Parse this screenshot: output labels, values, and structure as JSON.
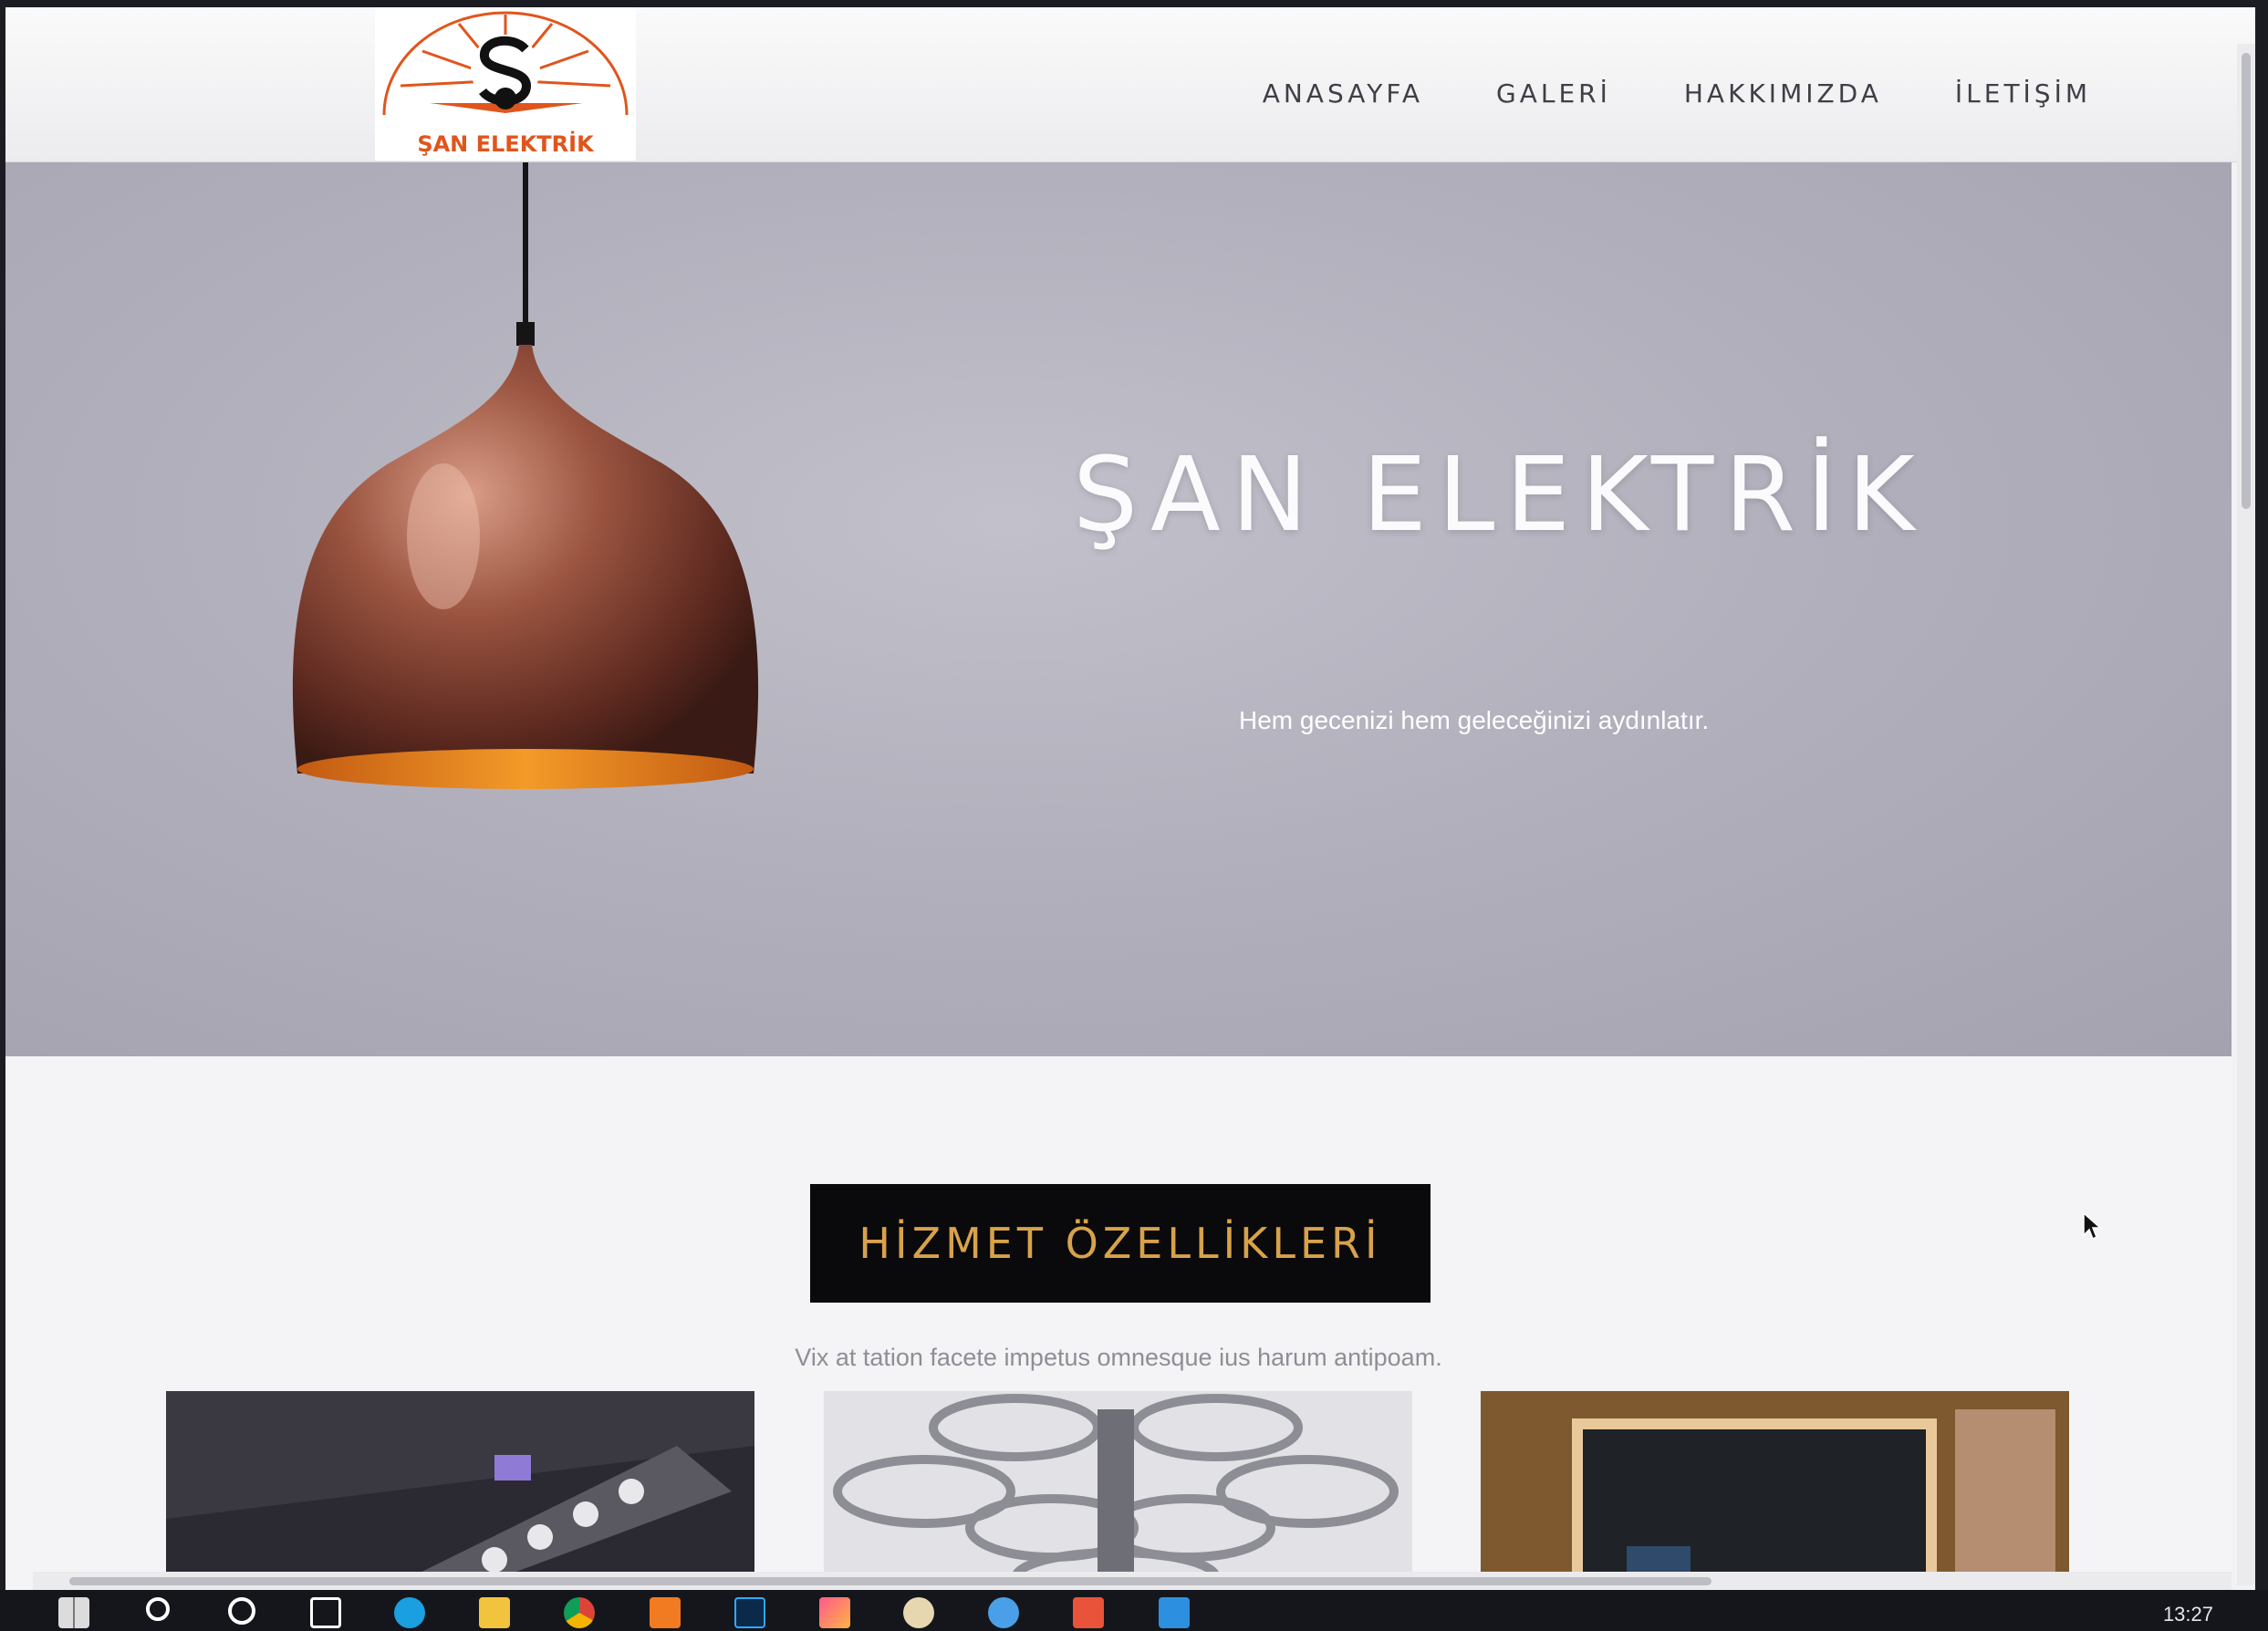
{
  "header": {
    "logo_text": "ŞAN ELEKTRİK",
    "nav": [
      "ANASAYFA",
      "GALERİ",
      "HAKKIMIZDA",
      "İLETİŞİM"
    ]
  },
  "hero": {
    "title": "ŞAN ELEKTRİK",
    "subtitle": "Hem gecenizi hem geleceğinizi aydınlatır."
  },
  "services": {
    "heading": "HİZMET ÖZELLİKLERİ",
    "description": "Vix at tation facete impetus omnesque ius harum antipoam."
  },
  "taskbar": {
    "clock": "13:27"
  },
  "colors": {
    "heading_bg": "#0a0a0c",
    "heading_text": "#d8a24b",
    "logo_accent": "#e0551c"
  }
}
